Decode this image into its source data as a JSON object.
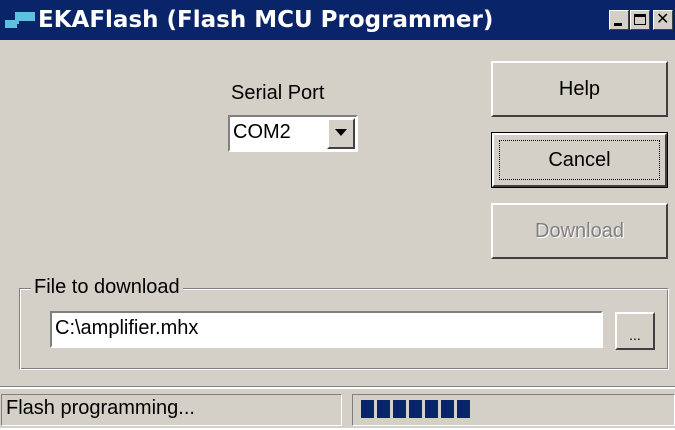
{
  "window": {
    "title": "EKAFlash (Flash MCU Programmer)",
    "app_icon": "flash-mcu-icon",
    "controls": {
      "minimize_icon": "minimize-icon",
      "maximize_icon": "maximize-icon",
      "close_icon": "close-icon"
    }
  },
  "serial_port": {
    "label": "Serial Port",
    "selected": "COM2",
    "dropdown_icon": "chevron-down-icon"
  },
  "buttons": {
    "help": "Help",
    "cancel": "Cancel",
    "download": "Download",
    "browse": "..."
  },
  "file_group": {
    "label": "File to download",
    "path": "C:\\amplifier.mhx"
  },
  "status": {
    "text": "Flash programming...",
    "progress_blocks": 7
  },
  "colors": {
    "titlebar": "#0a246a",
    "face": "#d4d0c8",
    "progress": "#0a246a",
    "disabled_text": "#808080"
  }
}
